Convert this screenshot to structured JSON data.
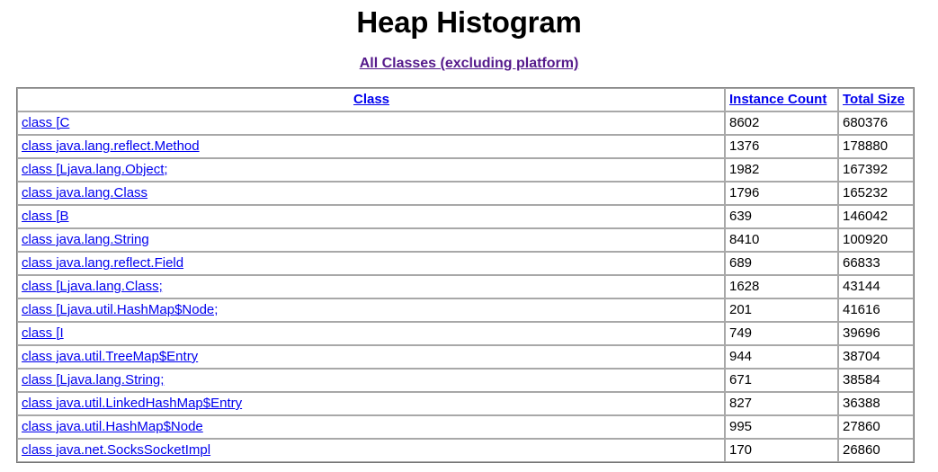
{
  "page": {
    "title": "Heap Histogram",
    "subtitle_link": "All Classes (excluding platform)",
    "link_color": "#0000ee",
    "visited_link_color": "#551a8b",
    "background_color": "#ffffff",
    "text_color": "#000000"
  },
  "table": {
    "headers": {
      "class": "Class",
      "instance_count": "Instance Count",
      "total_size": "Total Size"
    },
    "rows": [
      {
        "class": "class [C",
        "instance_count": "8602",
        "total_size": "680376"
      },
      {
        "class": "class java.lang.reflect.Method",
        "instance_count": "1376",
        "total_size": "178880"
      },
      {
        "class": "class [Ljava.lang.Object;",
        "instance_count": "1982",
        "total_size": "167392"
      },
      {
        "class": "class java.lang.Class",
        "instance_count": "1796",
        "total_size": "165232"
      },
      {
        "class": "class [B",
        "instance_count": "639",
        "total_size": "146042"
      },
      {
        "class": "class java.lang.String",
        "instance_count": "8410",
        "total_size": "100920"
      },
      {
        "class": "class java.lang.reflect.Field",
        "instance_count": "689",
        "total_size": "66833"
      },
      {
        "class": "class [Ljava.lang.Class;",
        "instance_count": "1628",
        "total_size": "43144"
      },
      {
        "class": "class [Ljava.util.HashMap$Node;",
        "instance_count": "201",
        "total_size": "41616"
      },
      {
        "class": "class [I",
        "instance_count": "749",
        "total_size": "39696"
      },
      {
        "class": "class java.util.TreeMap$Entry",
        "instance_count": "944",
        "total_size": "38704"
      },
      {
        "class": "class [Ljava.lang.String;",
        "instance_count": "671",
        "total_size": "38584"
      },
      {
        "class": "class java.util.LinkedHashMap$Entry",
        "instance_count": "827",
        "total_size": "36388"
      },
      {
        "class": "class java.util.HashMap$Node",
        "instance_count": "995",
        "total_size": "27860"
      },
      {
        "class": "class java.net.SocksSocketImpl",
        "instance_count": "170",
        "total_size": "26860"
      }
    ]
  }
}
